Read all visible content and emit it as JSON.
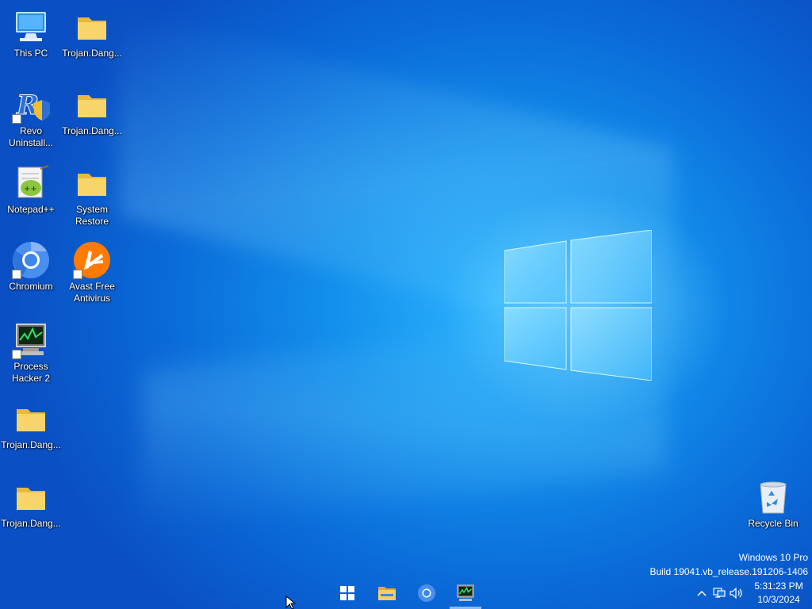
{
  "desktop": {
    "icons": [
      {
        "id": "this-pc",
        "label": "This PC",
        "icon": "computer-icon"
      },
      {
        "id": "trojan-folder-1",
        "label": "Trojan.Dang...",
        "icon": "folder-icon"
      },
      {
        "id": "revo",
        "label": "Revo\nUninstall...",
        "icon": "revo-uninstaller-icon"
      },
      {
        "id": "trojan-folder-2",
        "label": "Trojan.Dang...",
        "icon": "folder-icon"
      },
      {
        "id": "notepadpp",
        "label": "Notepad++",
        "icon": "notepad-plus-plus-icon"
      },
      {
        "id": "system-restore",
        "label": "System\nRestore",
        "icon": "folder-icon"
      },
      {
        "id": "chromium",
        "label": "Chromium",
        "icon": "chromium-icon"
      },
      {
        "id": "avast",
        "label": "Avast Free\nAntivirus",
        "icon": "avast-icon"
      },
      {
        "id": "process-hacker",
        "label": "Process\nHacker 2",
        "icon": "process-hacker-icon"
      },
      {
        "id": "trojan-folder-3",
        "label": "Trojan.Dang...",
        "icon": "folder-icon"
      },
      {
        "id": "trojan-folder-4",
        "label": "Trojan.Dang...",
        "icon": "folder-icon"
      },
      {
        "id": "recycle-bin",
        "label": "Recycle Bin",
        "icon": "recycle-bin-icon"
      }
    ]
  },
  "watermark": {
    "edition": "Windows 10 Pro",
    "build": "Build 19041.vb_release.191206-1406"
  },
  "taskbar": {
    "buttons": [
      {
        "name": "start",
        "icon": "windows-start-icon"
      },
      {
        "name": "file-explorer",
        "icon": "folder-icon"
      },
      {
        "name": "chromium",
        "icon": "chromium-icon"
      },
      {
        "name": "process-hacker",
        "icon": "process-hacker-icon"
      }
    ],
    "tray": {
      "icons": [
        "chevron-up-icon",
        "network-icon",
        "volume-icon"
      ],
      "time": "5:31:23 PM",
      "date": "10/3/2024"
    }
  },
  "colors": {
    "wallpaper_center": "#2fb6ff",
    "wallpaper_edge": "#0a50c4",
    "folder": "#f3cf5e",
    "avast_orange": "#ff7a00",
    "chromium_blue": "#4a8ff0"
  }
}
